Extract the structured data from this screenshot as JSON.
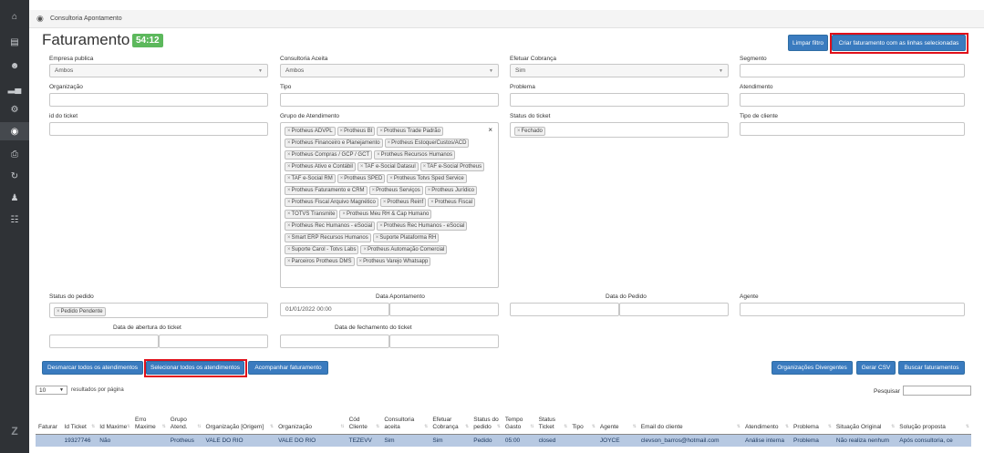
{
  "sidebar": {
    "icons": [
      "home-icon",
      "list-icon",
      "users-icon",
      "bar-chart-icon",
      "gear-icon",
      "billing-icon",
      "print-icon",
      "history-icon",
      "team-icon",
      "hierarchy-icon"
    ],
    "logo": "Z"
  },
  "breadcrumb": {
    "text": "Consultoria Apontamento"
  },
  "page": {
    "title": "Faturamento",
    "timer": "54:12"
  },
  "buttons": {
    "clear_filter": "Limpar filtro",
    "create_billing": "Criar faturamento com as linhas selecionadas",
    "unmark_all": "Desmarcar todos os atendimentos",
    "select_all": "Selecionar todos os atendimentos",
    "track_billing": "Acompanhar faturamento",
    "divergent_orgs": "Organizações Divergentes",
    "generate_csv": "Gerar CSV",
    "search_billing": "Buscar faturamentos"
  },
  "filters": {
    "empresa_publica": {
      "label": "Empresa publica",
      "value": "Ambos"
    },
    "consultoria_aceita": {
      "label": "Consultoria Aceita",
      "value": "Ambos"
    },
    "efetuar_cobranca": {
      "label": "Efetuar Cobrança",
      "value": "Sim"
    },
    "segmento": {
      "label": "Segmento",
      "value": ""
    },
    "organizacao": {
      "label": "Organização",
      "value": ""
    },
    "tipo": {
      "label": "Tipo",
      "value": ""
    },
    "problema": {
      "label": "Problema",
      "value": ""
    },
    "atendimento": {
      "label": "Atendimento",
      "value": ""
    },
    "id_ticket": {
      "label": "id do ticket",
      "value": ""
    },
    "grupo_atendimento": {
      "label": "Grupo de Atendimento",
      "clear": "×",
      "tags": [
        "Protheus ADVPL",
        "Protheus BI",
        "Protheus Trade Padrão",
        "Protheus Financeiro e Planejamento",
        "Protheus Estoque/Custos/ACD",
        "Protheus Compras / GCP / GCT",
        "Protheus Recursos Humanos",
        "Protheus Ativo e Contábil",
        "TAF e-Social Datasul",
        "TAF e-Social Protheus",
        "TAF e-Social RM",
        "Protheus SPED",
        "Protheus Totvs Sped Service",
        "Protheus Faturamento e CRM",
        "Protheus Serviços",
        "Protheus Jurídico",
        "Protheus Fiscal Arquivo Magnético",
        "Protheus Reinf",
        "Protheus Fiscal",
        "TOTVS Transmite",
        "Protheus Meu RH & Cap Humano",
        "Protheus Rec Humanos - eSocial",
        "Protheus Rec Humanos - eSocial",
        "Smart ERP Recursos Humanos",
        "Suporte Plataforma RH",
        "Suporte Carol - Totvs Labs",
        "Protheus Automação Comercial",
        "Parceiros Protheus DMS",
        "Protheus Varejo Whatsapp"
      ]
    },
    "status_ticket": {
      "label": "Status do ticket",
      "tags": [
        "Fechado"
      ]
    },
    "tipo_cliente": {
      "label": "Tipo de cliente",
      "value": ""
    },
    "status_pedido": {
      "label": "Status do pedido",
      "tags": [
        "Pedido Pendente"
      ]
    },
    "data_apontamento": {
      "label": "Data  Apontamento",
      "from": "01/01/2022 00:00",
      "to": ""
    },
    "data_pedido": {
      "label": "Data  do Pedido",
      "from": "",
      "to": ""
    },
    "agente": {
      "label": "Agente",
      "value": ""
    },
    "data_abertura": {
      "label": "Data de abertura  do ticket",
      "from": "",
      "to": ""
    },
    "data_fechamento": {
      "label": "Data de fechamento  do ticket",
      "from": "",
      "to": ""
    }
  },
  "table_controls": {
    "page_length": "10",
    "page_length_text": "resultados por página",
    "search_label": "Pesquisar"
  },
  "table": {
    "headers": [
      "Faturar",
      "Id Ticket",
      "Id Maxime",
      "Erro Maxime",
      "Grupo Atend.",
      "Organização [Origem]",
      "Organização",
      "Cód Cliente",
      "Consultoria aceita",
      "Efetuar Cobrança",
      "Status do pedido",
      "Tempo Gasto",
      "Status Ticket",
      "Tipo",
      "Agente",
      "Email do cliente",
      "Atendimento",
      "Problema",
      "Situação Original",
      "Solução proposta"
    ],
    "rows": [
      [
        "",
        "19327746",
        "Não",
        "",
        "Protheus",
        "VALE DO RIO",
        "VALE DO RIO",
        "TEZEVV",
        "Sim",
        "Sim",
        "Pedido",
        "05:00",
        "closed",
        "",
        "JOYCE",
        "clevson_barros@hotmail.com",
        "Análise interna",
        "Problema",
        "Não realiza nenhum",
        "Após consultoria, ce"
      ]
    ]
  }
}
